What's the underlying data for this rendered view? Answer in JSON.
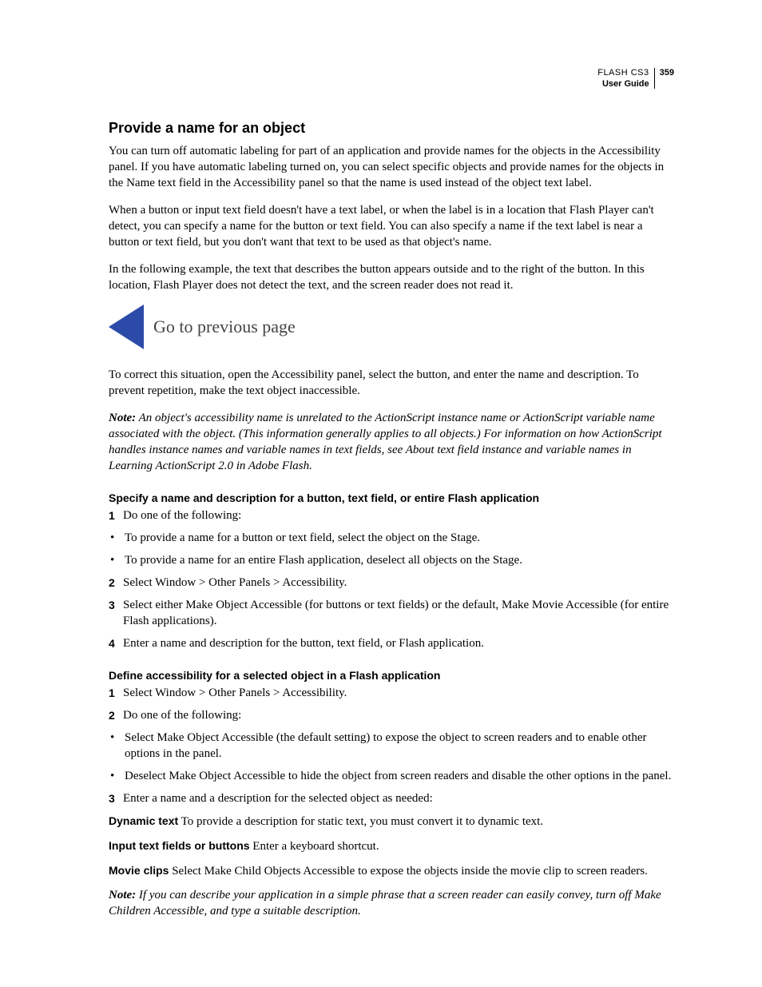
{
  "header": {
    "product": "FLASH CS3",
    "guide": "User Guide",
    "page": "359"
  },
  "section_title": "Provide a name for an object",
  "para1": "You can turn off automatic labeling for part of an application and provide names for the objects in the Accessibility panel. If you have automatic labeling turned on, you can select specific objects and provide names for the objects in the Name text field in the Accessibility panel so that the name is used instead of the object text label.",
  "para2": "When a button or input text field doesn't have a text label, or when the label is in a location that Flash Player can't detect, you can specify a name for the button or text field. You can also specify a name if the text label is near a button or text field, but you don't want that text to be used as that object's name.",
  "para3": "In the following example, the text that describes the button appears outside and to the right of the button. In this location, Flash Player does not detect the text, and the screen reader does not read it.",
  "illustration_caption": "Go to previous page",
  "para4": "To correct this situation, open the Accessibility panel, select the button, and enter the name and description. To prevent repetition, make the text object inaccessible.",
  "note1_label": "Note:",
  "note1_text": " An object's accessibility name is unrelated to the ActionScript instance name or ActionScript variable name associated with the object. (This information generally applies to all objects.) For information on how ActionScript handles instance names and variable names in text fields, see About text field instance and variable names in Learning ActionScript 2.0 in Adobe Flash.",
  "sub1": "Specify a name and description for a button, text field, or entire Flash application",
  "s1_step1": "Do one of the following:",
  "s1_b1": "To provide a name for a button or text field, select the object on the Stage.",
  "s1_b2": "To provide a name for an entire Flash application, deselect all objects on the Stage.",
  "s1_step2": "Select Window > Other Panels > Accessibility.",
  "s1_step3": "Select either Make Object Accessible (for buttons or text fields) or the default, Make Movie Accessible (for entire Flash applications).",
  "s1_step4": "Enter a name and description for the button, text field, or Flash application.",
  "sub2": "Define accessibility for a selected object in a Flash application",
  "s2_step1": "Select Window > Other Panels > Accessibility.",
  "s2_step2": "Do one of the following:",
  "s2_b1": "Select Make Object Accessible (the default setting) to expose the object to screen readers and to enable other options in the panel.",
  "s2_b2": "Deselect Make Object Accessible to hide the object from screen readers and disable the other options in the panel.",
  "s2_step3": "Enter a name and a description for the selected object as needed:",
  "def1_term": "Dynamic text",
  "def1_text": "  To provide a description for static text, you must convert it to dynamic text.",
  "def2_term": "Input text fields or buttons",
  "def2_text": "  Enter a keyboard shortcut.",
  "def3_term": "Movie clips",
  "def3_text": "  Select Make Child Objects Accessible to expose the objects inside the movie clip to screen readers.",
  "note2_label": "Note:",
  "note2_text": " If you can describe your application in a simple phrase that a screen reader can easily convey, turn off Make Children Accessible, and type a suitable description."
}
